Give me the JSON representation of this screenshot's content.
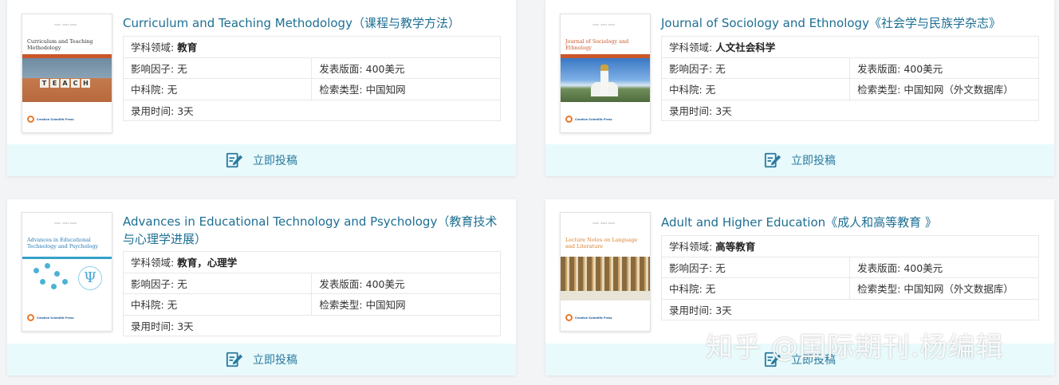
{
  "cards": [
    {
      "title": "Curriculum and Teaching Methodology（课程与教学方法）",
      "cover": {
        "issn": "ISSN: 2663-0000",
        "title": "Curriculum and Teaching Methodology",
        "word": [
          "T",
          "E",
          "A",
          "C",
          "H"
        ],
        "publisher": "Creative Scientific Press"
      },
      "field_label": "学科领域:",
      "field_value": "教育",
      "impact_label": "影响因子:",
      "impact_value": "无",
      "fee_label": "发表版面:",
      "fee_value": "400美元",
      "cas_label": "中科院:",
      "cas_value": "无",
      "index_label": "检索类型:",
      "index_value": "中国知网",
      "time_label": "录用时间:",
      "time_value": "3天",
      "submit_label": "立即投稿"
    },
    {
      "title": "Journal of Sociology and Ethnology《社会学与民族学杂志》",
      "cover": {
        "issn": "ISSN: 2663-0000",
        "title": "Journal of Sociology and Ethnology",
        "publisher": "Creative Scientific Press"
      },
      "field_label": "学科领域:",
      "field_value": "人文社会科学",
      "impact_label": "影响因子:",
      "impact_value": "无",
      "fee_label": "发表版面:",
      "fee_value": "400美元",
      "cas_label": "中科院:",
      "cas_value": "无",
      "index_label": "检索类型:",
      "index_value": "中国知网（外文数据库）",
      "time_label": "录用时间:",
      "time_value": "3天",
      "submit_label": "立即投稿"
    },
    {
      "title": "Advances in Educational Technology and Psychology（教育技术与心理学进展）",
      "cover": {
        "issn": "ISSN: 2663-0000",
        "title": "Advances in Educational Technology and Psychology",
        "psi": "Ψ",
        "publisher": "Creative Scientific Press"
      },
      "field_label": "学科领域:",
      "field_value": "教育，心理学",
      "impact_label": "影响因子:",
      "impact_value": "无",
      "fee_label": "发表版面:",
      "fee_value": "400美元",
      "cas_label": "中科院:",
      "cas_value": "无",
      "index_label": "检索类型:",
      "index_value": "中国知网",
      "time_label": "录用时间:",
      "time_value": "3天",
      "submit_label": "立即投稿"
    },
    {
      "title": "Adult and Higher Education《成人和高等教育 》",
      "cover": {
        "issn": "ISSN: 2663-0000",
        "title": "Lecture Notes on Language and Literature",
        "publisher": "Creative Scientific Press"
      },
      "field_label": "学科领域:",
      "field_value": "高等教育",
      "impact_label": "影响因子:",
      "impact_value": "无",
      "fee_label": "发表版面:",
      "fee_value": "400美元",
      "cas_label": "中科院:",
      "cas_value": "无",
      "index_label": "检索类型:",
      "index_value": "中国知网（外文数据库）",
      "time_label": "录用时间:",
      "time_value": "3天",
      "submit_label": "立即投稿"
    }
  ],
  "watermark": "知乎 @国际期刊.杨编辑",
  "colors": {
    "accent": "#1d6f93",
    "footer_bg": "#e9fafc",
    "icon": "#2a7a9f",
    "cover_band": "#c9572a"
  },
  "icons": {
    "submit": "edit-pen-icon"
  }
}
